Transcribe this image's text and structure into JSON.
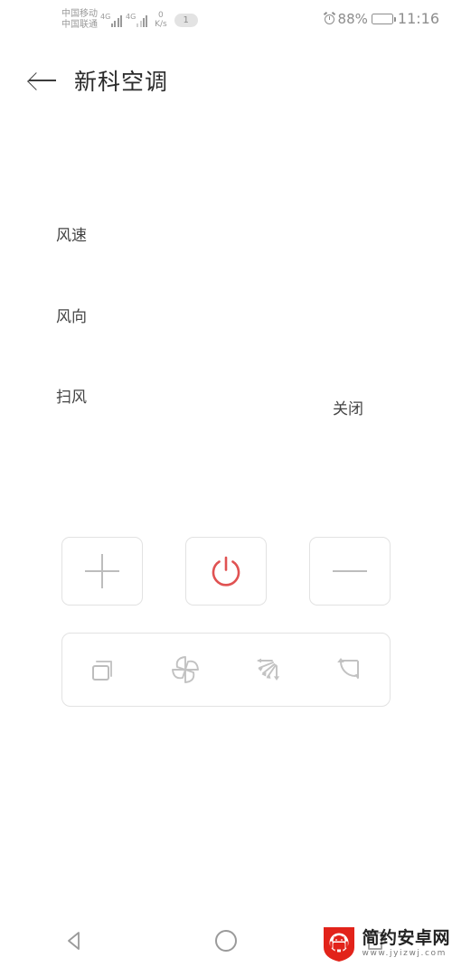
{
  "status_bar": {
    "carrier_primary": "中国移动",
    "carrier_secondary": "中国联通",
    "network_type_1": "4G",
    "network_type_2": "4G",
    "net_speed_value": "0",
    "net_speed_unit": "K/s",
    "notification_count": "1",
    "alarm_icon": "alarm-clock-icon",
    "battery_percent": "88%",
    "battery_level": 88,
    "clock": "11:16"
  },
  "app_bar": {
    "back_icon": "back-arrow-icon",
    "title": "新科空调"
  },
  "settings_rows": [
    {
      "label": "风速",
      "value": ""
    },
    {
      "label": "风向",
      "value": ""
    },
    {
      "label": "扫风",
      "value": "关闭"
    }
  ],
  "controls": {
    "increase_label": "+",
    "increase_icon": "plus-icon",
    "power_icon": "power-icon",
    "power_color": "#e05252",
    "decrease_label": "−",
    "decrease_icon": "minus-icon",
    "icon_color": "#bdbdbd",
    "border_color": "#e2e2e2"
  },
  "mode_strip": [
    {
      "name": "mode-icon",
      "tooltip": "模式"
    },
    {
      "name": "fan-pinwheel-icon",
      "tooltip": "风速"
    },
    {
      "name": "wind-direction-icon",
      "tooltip": "风向"
    },
    {
      "name": "swing-loop-icon",
      "tooltip": "扫风"
    }
  ],
  "nav_bar": {
    "back_icon": "nav-back-triangle-icon",
    "home_icon": "nav-home-circle-icon",
    "recents_icon": "nav-recents-square-icon"
  },
  "watermark": {
    "logo_icon": "android-shield-logo-icon",
    "site_name": "简约安卓网",
    "site_url": "www.jyizwj.com",
    "accent_color": "#e2231a"
  }
}
